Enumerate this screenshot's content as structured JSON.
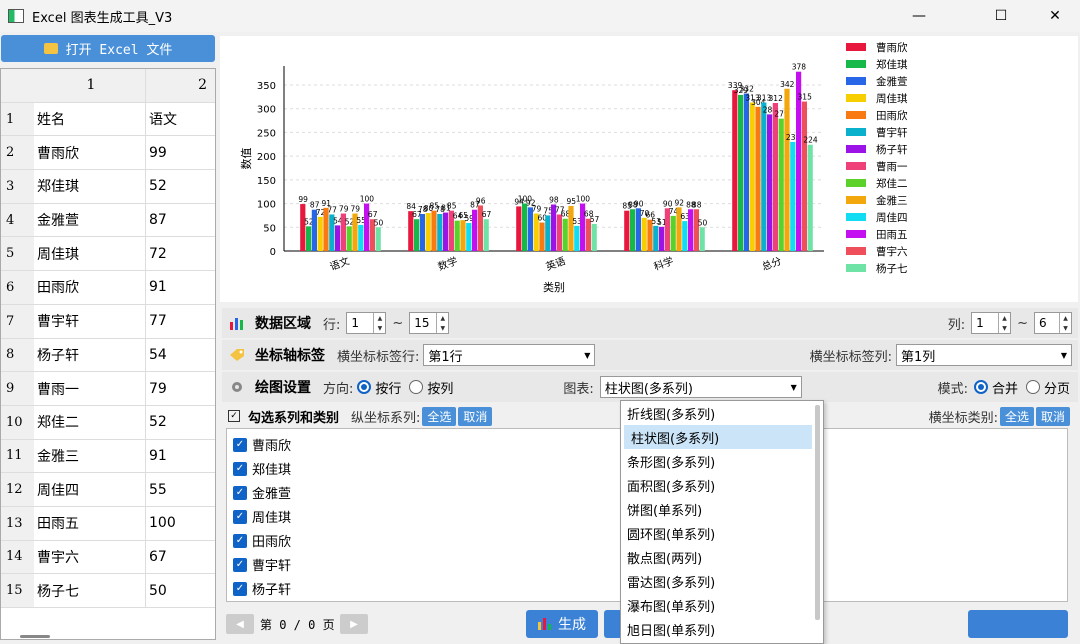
{
  "window": {
    "title": "Excel 图表生成工具_V3",
    "min": "—",
    "max": "☐",
    "close": "✕"
  },
  "left": {
    "open_button": "打开 Excel 文件",
    "col_headers": [
      "1",
      "2"
    ],
    "rows": [
      [
        "1",
        "姓名",
        "语文"
      ],
      [
        "2",
        "曹雨欣",
        "99"
      ],
      [
        "3",
        "郑佳琪",
        "52"
      ],
      [
        "4",
        "金雅萱",
        "87"
      ],
      [
        "5",
        "周佳琪",
        "72"
      ],
      [
        "6",
        "田雨欣",
        "91"
      ],
      [
        "7",
        "曹宇轩",
        "77"
      ],
      [
        "8",
        "杨子轩",
        "54"
      ],
      [
        "9",
        "曹雨一",
        "79"
      ],
      [
        "10",
        "郑佳二",
        "52"
      ],
      [
        "11",
        "金雅三",
        "91"
      ],
      [
        "12",
        "周佳四",
        "55"
      ],
      [
        "13",
        "田雨五",
        "100"
      ],
      [
        "14",
        "曹宇六",
        "67"
      ],
      [
        "15",
        "杨子七",
        "50"
      ]
    ]
  },
  "chart_data": {
    "type": "bar",
    "xlabel": "类别",
    "ylabel": "数值",
    "ylim": [
      0,
      390
    ],
    "yticks": [
      0,
      50,
      100,
      150,
      200,
      250,
      300,
      350
    ],
    "categories": [
      "语文",
      "数学",
      "英语",
      "科学",
      "总分"
    ],
    "series": [
      {
        "name": "曹雨欣",
        "color": "#e8173e",
        "values": [
          99,
          84,
          94,
          85,
          339
        ]
      },
      {
        "name": "郑佳琪",
        "color": "#16b84a",
        "values": [
          52,
          67,
          100,
          88,
          329
        ]
      },
      {
        "name": "金雅萱",
        "color": "#2766e6",
        "values": [
          87,
          78,
          92,
          90,
          332
        ]
      },
      {
        "name": "周佳琪",
        "color": "#f7ce00",
        "values": [
          72,
          80,
          79,
          70,
          313
        ]
      },
      {
        "name": "田雨欣",
        "color": "#fa7a12",
        "values": [
          91,
          85,
          60,
          66,
          304
        ]
      },
      {
        "name": "曹宇轩",
        "color": "#0ab1cc",
        "values": [
          77,
          78,
          75,
          53,
          313
        ]
      },
      {
        "name": "杨子轩",
        "color": "#9b13e6",
        "values": [
          54,
          81,
          98,
          51,
          288
        ]
      },
      {
        "name": "曹雨一",
        "color": "#f0407a",
        "values": [
          79,
          85,
          77,
          90,
          312
        ]
      },
      {
        "name": "郑佳二",
        "color": "#5cd12a",
        "values": [
          52,
          64,
          68,
          74,
          279
        ]
      },
      {
        "name": "金雅三",
        "color": "#f2a70c",
        "values": [
          79,
          65,
          95,
          92,
          342
        ]
      },
      {
        "name": "周佳四",
        "color": "#11dcf2",
        "values": [
          55,
          59,
          53,
          63,
          230
        ]
      },
      {
        "name": "田雨五",
        "color": "#c40ff0",
        "values": [
          100,
          87,
          100,
          88,
          378
        ]
      },
      {
        "name": "曹宇六",
        "color": "#ef4f5a",
        "values": [
          67,
          96,
          68,
          88,
          315
        ]
      },
      {
        "name": "杨子七",
        "color": "#6fe3a6",
        "values": [
          50,
          67,
          57,
          50,
          224
        ]
      }
    ]
  },
  "data_region": {
    "title": "数据区域",
    "row_label": "行:",
    "row_from": "1",
    "row_to": "15",
    "tilde": "~",
    "col_label": "列:",
    "col_from": "1",
    "col_to": "6"
  },
  "axis_labels": {
    "title": "坐标轴标签",
    "x_label": "横坐标标签行:",
    "x_value": "第1行",
    "y_label": "横坐标标签列:",
    "y_value": "第1列"
  },
  "plot_settings": {
    "title": "绘图设置",
    "direction_label": "方向:",
    "by_row": "按行",
    "by_col": "按列",
    "chart_label": "图表:",
    "chart_value": "柱状图(多系列)",
    "mode_label": "模式:",
    "merge": "合并",
    "split": "分页"
  },
  "series_select": {
    "title": "勾选系列和类别",
    "y_series_label": "纵坐标系列:",
    "select_all": "全选",
    "cancel": "取消",
    "x_cat_label": "横坐标类别:",
    "select_all2": "全选",
    "cancel2": "取消",
    "items": [
      "曹雨欣",
      "郑佳琪",
      "金雅萱",
      "周佳琪",
      "田雨欣",
      "曹宇轩",
      "杨子轩"
    ]
  },
  "dropdown": {
    "options": [
      "折线图(多系列)",
      "柱状图(多系列)",
      "条形图(多系列)",
      "面积图(多系列)",
      "饼图(单系列)",
      "圆环图(单系列)",
      "散点图(两列)",
      "雷达图(多系列)",
      "瀑布图(单系列)",
      "旭日图(单系列)"
    ],
    "selected": "柱状图(多系列)"
  },
  "bottom": {
    "page_text": "第 0 / 0 页",
    "generate": "生成",
    "prev": "◀",
    "next": "▶"
  }
}
